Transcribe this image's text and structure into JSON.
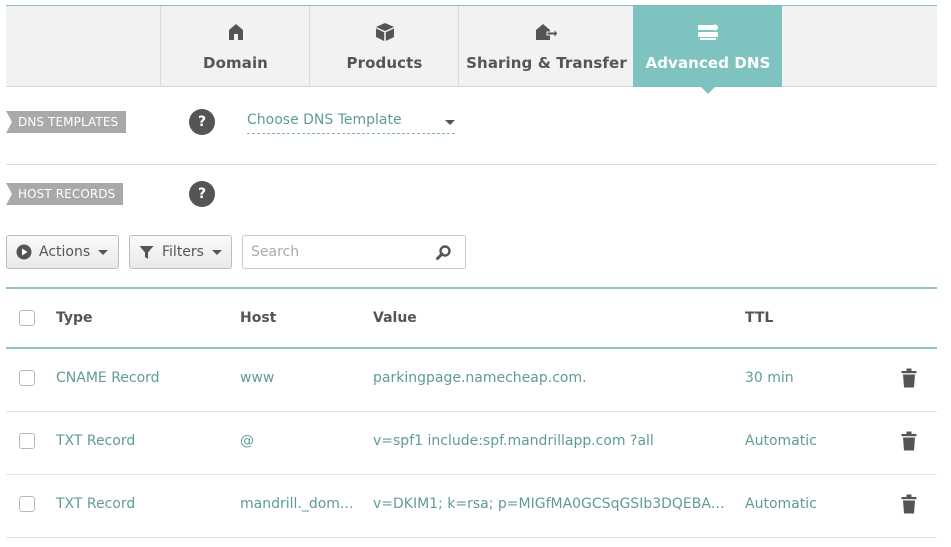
{
  "tabs": [
    {
      "label": "Domain",
      "icon": "home-icon",
      "active": false
    },
    {
      "label": "Products",
      "icon": "box-icon",
      "active": false
    },
    {
      "label": "Sharing & Transfer",
      "icon": "transfer-icon",
      "active": false
    },
    {
      "label": "Advanced DNS",
      "icon": "dns-server-icon",
      "active": true
    }
  ],
  "dns_templates": {
    "section_label": "DNS TEMPLATES",
    "help": "?",
    "select_value": "Choose DNS Template"
  },
  "host_records": {
    "section_label": "HOST RECORDS",
    "help": "?"
  },
  "toolbar": {
    "actions_label": "Actions",
    "filters_label": "Filters",
    "search_placeholder": "Search"
  },
  "table": {
    "headers": {
      "type": "Type",
      "host": "Host",
      "value": "Value",
      "ttl": "TTL"
    },
    "rows": [
      {
        "type": "CNAME Record",
        "host": "www",
        "value": "parkingpage.namecheap.com.",
        "ttl": "30 min"
      },
      {
        "type": "TXT Record",
        "host": "@",
        "value": "v=spf1 include:spf.mandrillapp.com ?all",
        "ttl": "Automatic"
      },
      {
        "type": "TXT Record",
        "host": "mandrill._dom...",
        "value": "v=DKIM1; k=rsa; p=MIGfMA0GCSqGSIb3DQEBAQU...",
        "ttl": "Automatic"
      }
    ]
  },
  "colors": {
    "accent": "#7ec3c0",
    "link_text": "#5f9c98",
    "section_label_bg": "#a9a9a9"
  }
}
